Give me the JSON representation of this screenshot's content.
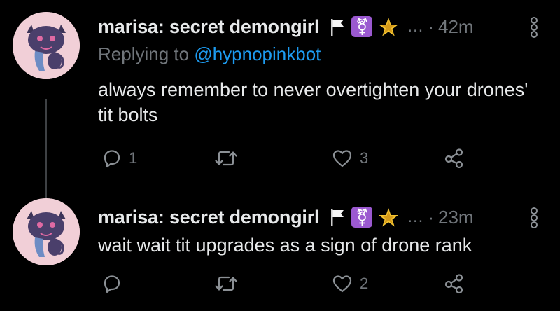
{
  "tweets": [
    {
      "display_name": "marisa: secret demongirl",
      "time": "42m",
      "ellipsis": "...",
      "time_separator": "·",
      "reply_prefix": "Replying to",
      "reply_handle": "@hypnopinkbot",
      "text": "always remember to never overtighten your drones' tit bolts",
      "replies": "1",
      "retweets": "",
      "likes": "3"
    },
    {
      "display_name": "marisa: secret demongirl",
      "time": "23m",
      "ellipsis": "...",
      "time_separator": "·",
      "text": "wait wait tit upgrades as a sign of drone rank",
      "replies": "",
      "retweets": "",
      "likes": "2"
    }
  ],
  "badges": {
    "trans_symbol": "⚧"
  },
  "icons": [
    "flag-icon",
    "transgender-icon",
    "pentagram-icon",
    "more-icon",
    "reply-icon",
    "retweet-icon",
    "like-icon",
    "share-icon"
  ],
  "colors": {
    "background": "#000000",
    "text": "#e7e9ea",
    "muted": "#71767b",
    "link": "#1d9bf0",
    "trans_badge": "#9b59d0",
    "avatar_bg": "#f1cfd7"
  }
}
